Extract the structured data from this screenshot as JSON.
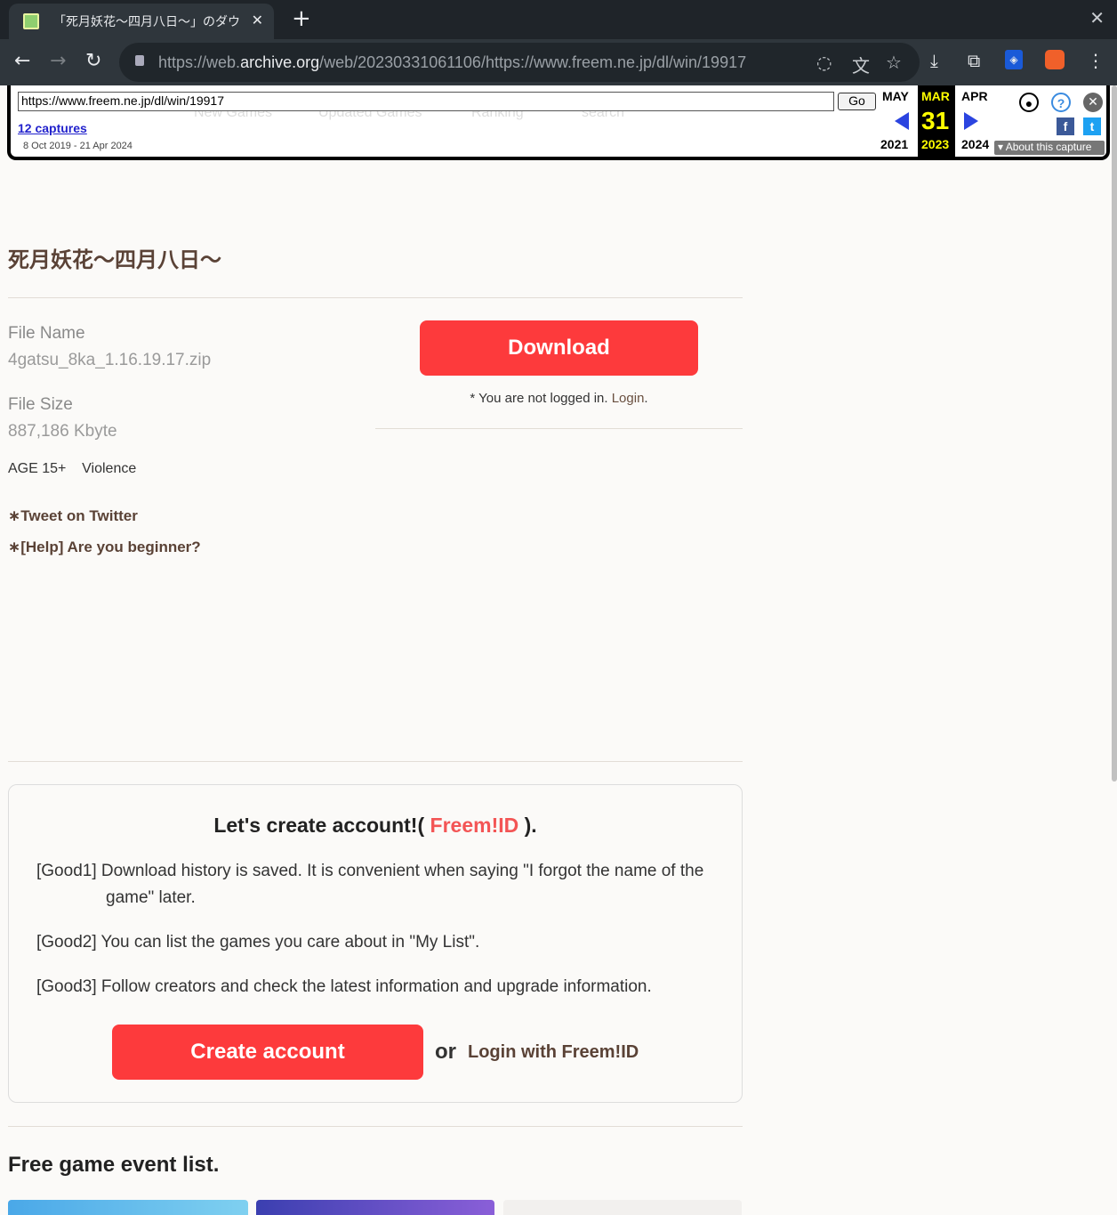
{
  "browser": {
    "tab_title": "「死月妖花〜四月八日〜」のダウ",
    "url_prefix": "https://web.",
    "url_host": "archive.org",
    "url_rest": "/web/20230331061106/https://www.freem.ne.jp/dl/win/19917"
  },
  "wayback": {
    "url_input": "https://www.freem.ne.jp/dl/win/19917",
    "go_label": "Go",
    "captures": "12 captures",
    "range": "8 Oct 2019 - 21 Apr 2024",
    "prev_month": "MAY",
    "prev_year": "2021",
    "cur_month": "MAR",
    "cur_day": "31",
    "cur_year": "2023",
    "next_month": "APR",
    "next_year": "2024",
    "about": "About this capture"
  },
  "ghost_nav": [
    "New Games",
    "Updated Games",
    "Ranking",
    "search"
  ],
  "page": {
    "title": "死月妖花〜四月八日〜",
    "file_name_label": "File Name",
    "file_name": "4gatsu_8ka_1.16.19.17.zip",
    "file_size_label": "File Size",
    "file_size": "887,186 Kbyte",
    "age": "AGE 15+",
    "content_tag": "Violence",
    "tweet_link": "∗Tweet on Twitter",
    "help_link": "∗[Help] Are you beginner?",
    "download_button": "Download",
    "not_logged_text": "* You are not logged in. ",
    "login_link": "Login",
    "not_logged_end": "."
  },
  "account": {
    "heading_pre": "Let's create account!( ",
    "heading_id": "Freem!ID",
    "heading_post": " ).",
    "goods": [
      "[Good1] Download history is saved. It is convenient when saying \"I forgot the name of the game\" later.",
      "[Good2] You can list the games you care about in \"My List\".",
      "[Good3] Follow creators and check the latest information and upgrade information."
    ],
    "create_button": "Create account",
    "or": "or",
    "login_with": "Login with Freem!ID"
  },
  "events": {
    "heading": "Free game event list."
  },
  "colors": {
    "accent_red": "#fd3a3c",
    "brown_text": "#5a4236",
    "freem_id": "#f35555"
  }
}
